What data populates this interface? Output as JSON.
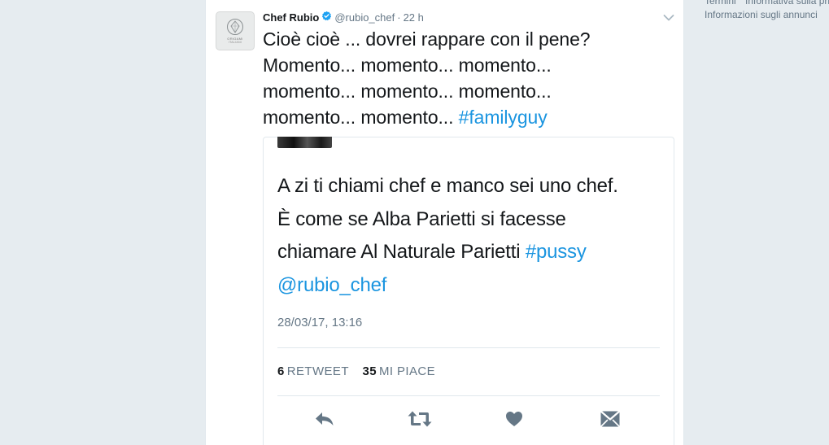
{
  "footer": {
    "links": [
      "Termini",
      "Informativa sulla pri"
    ],
    "ads_info": "Informazioni sugli annunci"
  },
  "tweet": {
    "author": {
      "name": "Chef Rubio",
      "handle": "@rubio_chef",
      "verified": true,
      "avatar_icon": "origami-logo-icon",
      "avatar_text_line1": "ORIGAMI",
      "avatar_text_line2": "ITALIANI"
    },
    "separator": "·",
    "time": "22 h",
    "text_lines": [
      "Cioè cioè ... dovrei rappare con il pene?",
      "Momento... momento... momento...",
      "momento... momento... momento..."
    ],
    "text_last_prefix": "momento... momento... ",
    "hashtag": "#familyguy"
  },
  "quoted_tweet": {
    "lines": [
      "A zi ti chiami chef e manco sei uno chef.",
      "È come se Alba Parietti si facesse"
    ],
    "line3_prefix": "chiamare Al Naturale Parietti ",
    "hashtag": "#pussy",
    "mention": "@rubio_chef",
    "date": "28/03/17, 13:16",
    "retweets_count": "6",
    "retweets_label": "RETWEET",
    "likes_count": "35",
    "likes_label": "MI PIACE"
  },
  "actions": [
    "reply-icon",
    "retweet-icon",
    "heart-icon",
    "direct-message-icon"
  ],
  "colors": {
    "link": "#1b95e0",
    "verified": "#1da1f2",
    "icon": "#657786",
    "background": "#e6ecf0"
  }
}
